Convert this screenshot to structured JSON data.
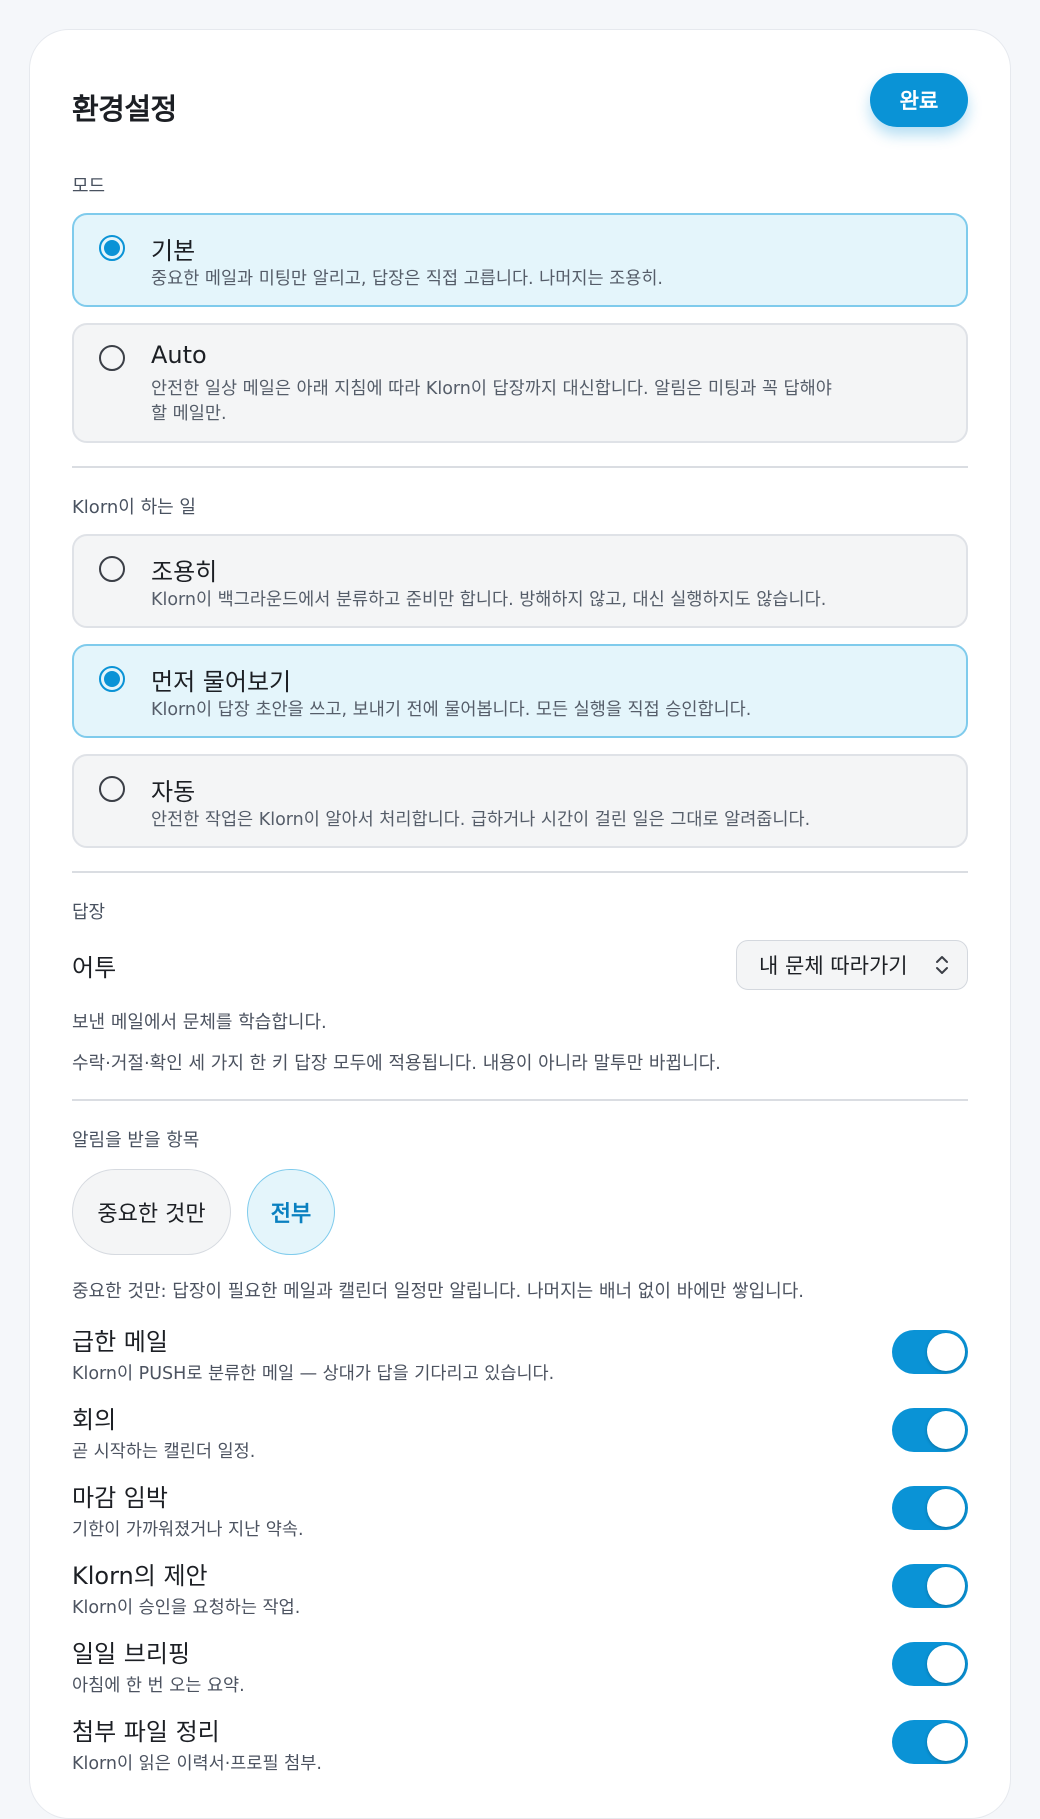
{
  "header": {
    "title": "환경설정",
    "done_label": "완료"
  },
  "mode": {
    "label": "모드",
    "options": [
      {
        "title": "기본",
        "desc": "중요한 메일과 미팅만 알리고, 답장은 직접 고릅니다. 나머지는 조용히.",
        "selected": true
      },
      {
        "title": "Auto",
        "desc": "안전한 일상 메일은 아래 지침에 따라 Klorn이 답장까지 대신합니다. 알림은 미팅과 꼭 답해야 할 메일만.",
        "selected": false
      }
    ]
  },
  "behavior": {
    "label": "Klorn이 하는 일",
    "options": [
      {
        "title": "조용히",
        "desc": "Klorn이 백그라운드에서 분류하고 준비만 합니다. 방해하지 않고, 대신 실행하지도 않습니다.",
        "selected": false
      },
      {
        "title": "먼저 물어보기",
        "desc": "Klorn이 답장 초안을 쓰고, 보내기 전에 물어봅니다. 모든 실행을 직접 승인합니다.",
        "selected": true
      },
      {
        "title": "자동",
        "desc": "안전한 작업은 Klorn이 알아서 처리합니다. 급하거나 시간이 걸린 일은 그대로 알려줍니다.",
        "selected": false
      }
    ]
  },
  "reply": {
    "label": "답장",
    "tone_label": "어투",
    "tone_value": "내 문체 따라가기",
    "help1": "보낸 메일에서 문체를 학습합니다.",
    "help2": "수락·거절·확인 세 가지 한 키 답장 모두에 적용됩니다. 내용이 아니라 말투만 바뀝니다."
  },
  "notifications": {
    "label": "알림을 받을 항목",
    "filters": [
      {
        "label": "중요한 것만",
        "active": false
      },
      {
        "label": "전부",
        "active": true
      }
    ],
    "help": "중요한 것만: 답장이 필요한 메일과 캘린더 일정만 알립니다. 나머지는 배너 없이 바에만 쌓입니다.",
    "items": [
      {
        "title": "급한 메일",
        "desc": "Klorn이 PUSH로 분류한 메일 — 상대가 답을 기다리고 있습니다.",
        "on": true
      },
      {
        "title": "회의",
        "desc": "곧 시작하는 캘린더 일정.",
        "on": true
      },
      {
        "title": "마감 임박",
        "desc": "기한이 가까워졌거나 지난 약속.",
        "on": true
      },
      {
        "title": "Klorn의 제안",
        "desc": "Klorn이 승인을 요청하는 작업.",
        "on": true
      },
      {
        "title": "일일 브리핑",
        "desc": "아침에 한 번 오는 요약.",
        "on": true
      },
      {
        "title": "첨부 파일 정리",
        "desc": "Klorn이 읽은 이력서·프로필 첨부.",
        "on": true
      }
    ]
  },
  "colors": {
    "accent": "#0a93d6",
    "selected_bg": "#e4f5fb",
    "selected_border": "#7fcbec"
  }
}
